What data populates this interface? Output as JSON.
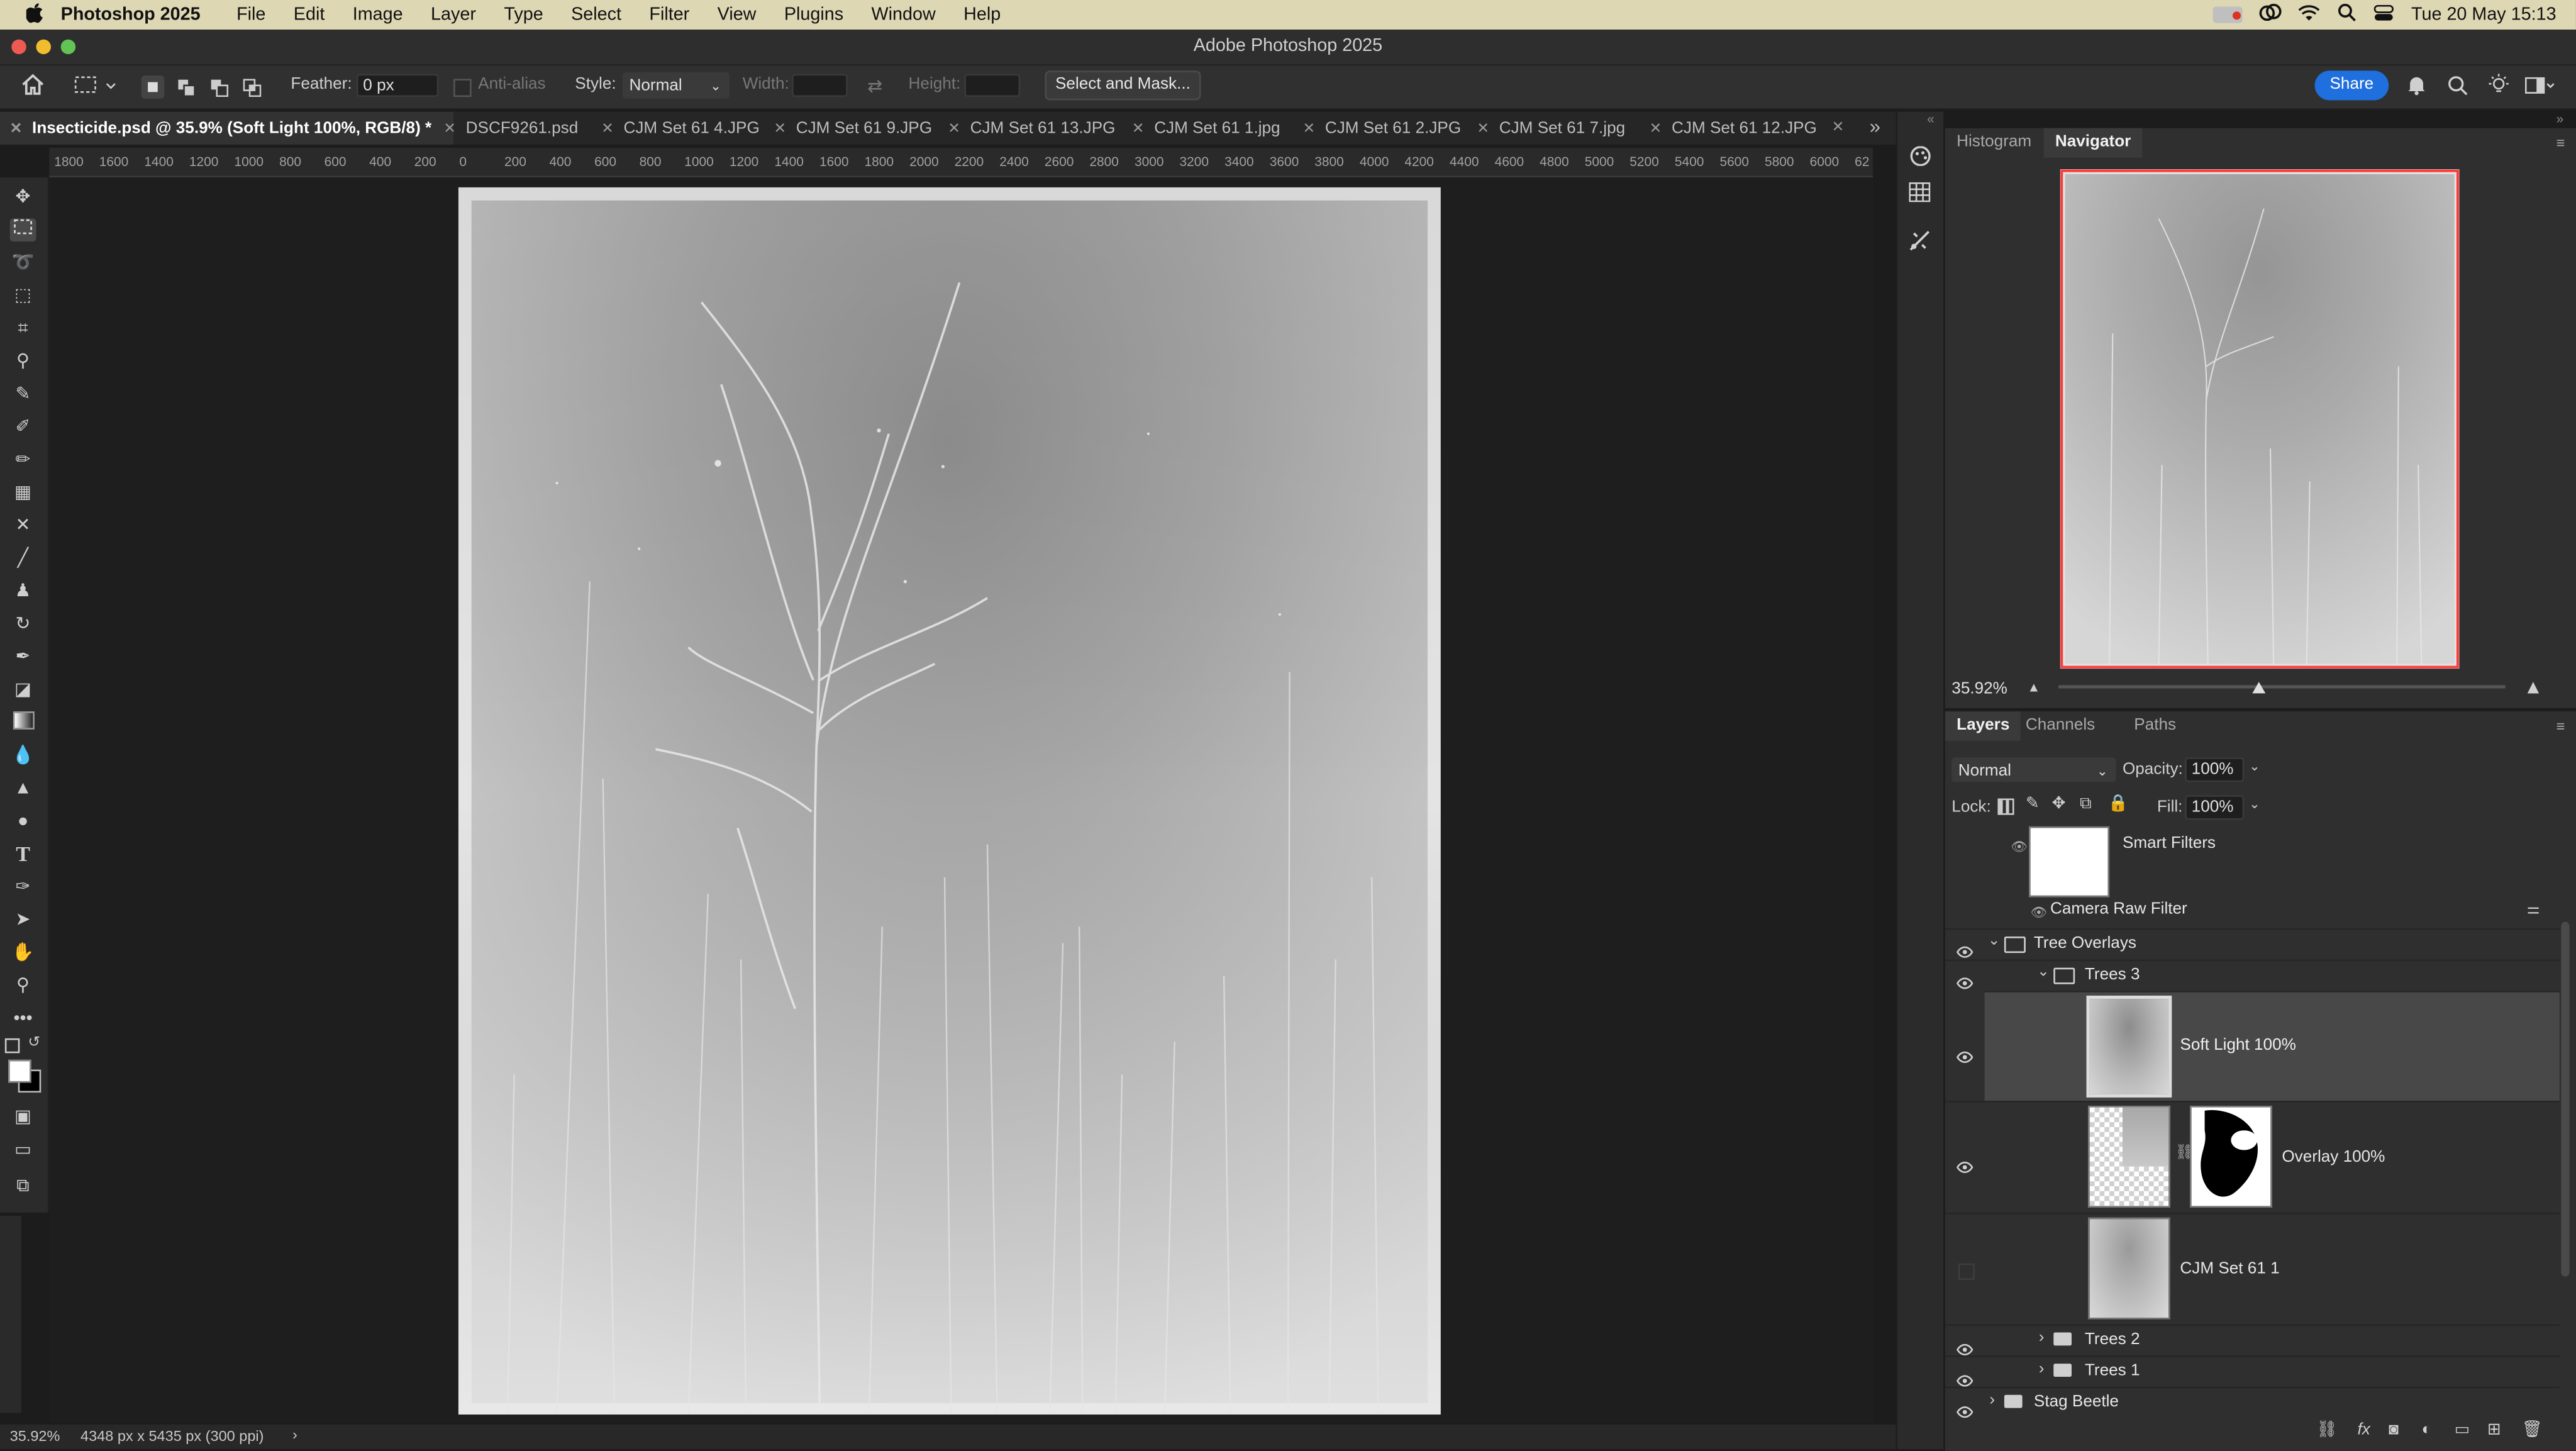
{
  "menubar": {
    "app_name": "Photoshop 2025",
    "items": [
      "File",
      "Edit",
      "Image",
      "Layer",
      "Type",
      "Select",
      "Filter",
      "View",
      "Plugins",
      "Window",
      "Help"
    ],
    "clock": "Tue 20 May  15:13"
  },
  "window": {
    "title": "Adobe Photoshop 2025"
  },
  "options_bar": {
    "feather_label": "Feather:",
    "feather_value": "0 px",
    "antialias_label": "Anti-alias",
    "style_label": "Style:",
    "style_value": "Normal",
    "width_label": "Width:",
    "height_label": "Height:",
    "select_mask_label": "Select and Mask...",
    "share_label": "Share"
  },
  "tabs": [
    "Insecticide.psd @ 35.9% (Soft Light 100%, RGB/8) *",
    "DSCF9261.psd",
    "CJM Set 61 4.JPG",
    "CJM Set 61 9.JPG",
    "CJM Set 61 13.JPG",
    "CJM Set 61 1.jpg",
    "CJM Set 61 2.JPG",
    "CJM Set 61 7.jpg",
    "CJM Set 61 12.JPG"
  ],
  "ruler": [
    "1800",
    "1600",
    "1400",
    "1200",
    "1000",
    "800",
    "600",
    "400",
    "200",
    "0",
    "200",
    "400",
    "600",
    "800",
    "1000",
    "1200",
    "1400",
    "1600",
    "1800",
    "2000",
    "2200",
    "2400",
    "2600",
    "2800",
    "3000",
    "3200",
    "3400",
    "3600",
    "3800",
    "4000",
    "4200",
    "4400",
    "4600",
    "4800",
    "5000",
    "5200",
    "5400",
    "5600",
    "5800",
    "6000",
    "62"
  ],
  "status": {
    "zoom": "35.92%",
    "doc_size": "4348 px x 5435 px (300 ppi)"
  },
  "navigator": {
    "tabs": [
      "Histogram",
      "Navigator"
    ],
    "zoom": "35.92%",
    "zoom_fraction": 0.45
  },
  "layers_panel": {
    "tabs": [
      "Layers",
      "Channels",
      "Paths"
    ],
    "blend_mode": "Normal",
    "opacity_label": "Opacity:",
    "opacity_value": "100%",
    "lock_label": "Lock:",
    "fill_label": "Fill:",
    "fill_value": "100%",
    "smart_filters": "Smart Filters",
    "camera_raw": "Camera Raw Filter",
    "group_tree_overlays": "Tree Overlays",
    "group_trees3": "Trees 3",
    "layer_soft_light": "Soft Light 100%",
    "layer_overlay": "Overlay 100%",
    "layer_cjm": "CJM Set 61 1",
    "group_trees2": "Trees 2",
    "group_trees1": "Trees 1",
    "group_stag": "Stag Beetle"
  },
  "colors": {
    "accent": "#1f6fde",
    "menubar": "#ded7b4",
    "panel": "#2f2f2f",
    "selection": "#3c3c3c"
  }
}
